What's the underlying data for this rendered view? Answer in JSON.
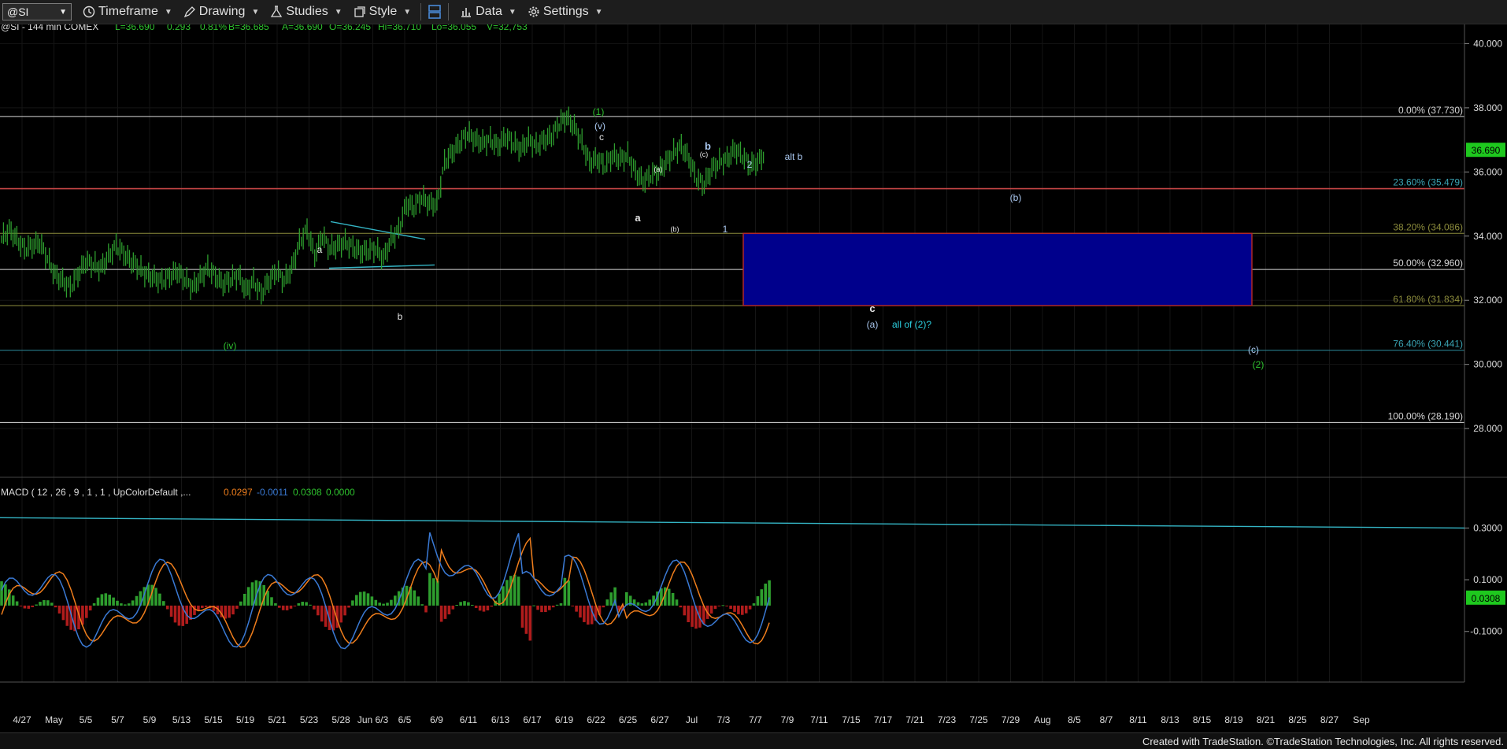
{
  "toolbar": {
    "symbol": "@SI",
    "timeframe": "Timeframe",
    "drawing": "Drawing",
    "studies": "Studies",
    "style": "Style",
    "data": "Data",
    "settings": "Settings"
  },
  "header": {
    "title": "@SI - 144 min  COMEX",
    "L": "L=36.690",
    "chg": "0.293",
    "pct": "0.81%",
    "B": "B=36.685",
    "A": "A=36.690",
    "O": "O=36.245",
    "Hi": "Hi=36.710",
    "Lo": "Lo=36.055",
    "V": "V=32,753"
  },
  "colors": {
    "price": "#2e9e2e",
    "macd_line": "#3a7ad5",
    "signal_line": "#f07e1c",
    "hist_up": "#2e9e2e",
    "hist_down": "#b01c1c",
    "target_box": "#00008c",
    "label_blue": "#aac8f0",
    "label_green": "#2ec22e",
    "trendline": "#34b4c4",
    "red_line": "#c84646",
    "olive_line": "#8c8c3c"
  },
  "chart_data": {
    "type": "line",
    "instrument": "@SI",
    "interval": "144 min",
    "ylim": [
      26.8,
      40.6
    ],
    "y_ticks": [
      "40.000",
      "38.000",
      "36.000",
      "34.000",
      "32.000",
      "30.000",
      "28.000"
    ],
    "last_price": "36.690",
    "x_ticks": [
      "4/27",
      "May",
      "5/5",
      "5/7",
      "5/9",
      "5/13",
      "5/15",
      "5/19",
      "5/21",
      "5/23",
      "5/28",
      "Jun 6/3",
      "6/5",
      "6/9",
      "6/11",
      "6/13",
      "6/17",
      "6/19",
      "6/22",
      "6/25",
      "6/27",
      "Jul",
      "7/3",
      "7/7",
      "7/9",
      "7/11",
      "7/15",
      "7/17",
      "7/21",
      "7/23",
      "7/25",
      "7/29",
      "Aug",
      "8/5",
      "8/7",
      "8/11",
      "8/13",
      "8/15",
      "8/19",
      "8/21",
      "8/25",
      "8/27",
      "Sep"
    ],
    "price_path": [
      [
        0,
        33.9
      ],
      [
        1,
        34.2
      ],
      [
        3,
        33.6
      ],
      [
        5,
        33.8
      ],
      [
        7,
        32.8
      ],
      [
        9,
        32.4
      ],
      [
        11,
        33.2
      ],
      [
        13,
        33.0
      ],
      [
        15,
        33.7
      ],
      [
        17,
        33.2
      ],
      [
        19,
        32.8
      ],
      [
        21,
        32.6
      ],
      [
        23,
        32.9
      ],
      [
        25,
        32.4
      ],
      [
        27,
        33.0
      ],
      [
        29,
        32.5
      ],
      [
        31,
        32.8
      ],
      [
        32,
        32.3
      ],
      [
        33,
        32.6
      ],
      [
        34,
        32.2
      ],
      [
        35,
        32.6
      ],
      [
        36,
        32.9
      ],
      [
        37,
        32.6
      ],
      [
        38,
        33.0
      ],
      [
        39,
        33.8
      ],
      [
        40,
        34.2
      ],
      [
        41,
        33.4
      ],
      [
        42,
        34.0
      ],
      [
        43,
        33.6
      ],
      [
        45,
        33.8
      ],
      [
        47,
        33.5
      ],
      [
        49,
        33.6
      ],
      [
        50,
        33.3
      ],
      [
        51,
        33.9
      ],
      [
        52,
        34.2
      ],
      [
        53,
        35.0
      ],
      [
        54,
        34.9
      ],
      [
        55,
        35.2
      ],
      [
        56,
        35.0
      ],
      [
        57,
        35.0
      ],
      [
        58,
        36.3
      ],
      [
        59,
        36.6
      ],
      [
        60,
        36.9
      ],
      [
        61,
        37.2
      ],
      [
        62,
        37.0
      ],
      [
        63,
        36.9
      ],
      [
        64,
        37.0
      ],
      [
        65,
        36.8
      ],
      [
        66,
        37.1
      ],
      [
        67,
        36.9
      ],
      [
        68,
        36.7
      ],
      [
        69,
        37.0
      ],
      [
        70,
        36.8
      ],
      [
        71,
        37.0
      ],
      [
        72,
        37.1
      ],
      [
        73,
        37.5
      ],
      [
        74,
        37.7
      ],
      [
        75,
        37.4
      ],
      [
        76,
        36.9
      ],
      [
        77,
        36.3
      ],
      [
        78,
        36.4
      ],
      [
        79,
        36.2
      ],
      [
        80,
        36.5
      ],
      [
        81,
        36.4
      ],
      [
        82,
        36.5
      ],
      [
        83,
        36.0
      ],
      [
        84,
        35.7
      ],
      [
        85,
        35.9
      ],
      [
        86,
        36.0
      ],
      [
        87,
        36.3
      ],
      [
        88,
        36.6
      ],
      [
        89,
        36.8
      ],
      [
        90,
        36.4
      ],
      [
        91,
        35.8
      ],
      [
        92,
        35.6
      ],
      [
        93,
        36.1
      ],
      [
        94,
        36.3
      ],
      [
        95,
        36.4
      ],
      [
        96,
        36.7
      ],
      [
        97,
        36.5
      ],
      [
        98,
        36.2
      ],
      [
        99,
        36.3
      ],
      [
        100,
        36.6
      ]
    ],
    "fib_levels": [
      {
        "label": "0.00% (37.730)",
        "value": 37.73
      },
      {
        "label": "23.60% (35.479)",
        "value": 35.479
      },
      {
        "label": "38.20% (34.086)",
        "value": 34.086
      },
      {
        "label": "50.00% (32.960)",
        "value": 32.96
      },
      {
        "label": "61.80% (31.834)",
        "value": 31.834
      },
      {
        "label": "76.40% (30.441)",
        "value": 30.441
      },
      {
        "label": "100.00% (28.190)",
        "value": 28.19
      }
    ],
    "target_zone": {
      "top": 34.086,
      "bottom": 31.834
    },
    "wave_labels": [
      {
        "text": "(1)",
        "color": "green"
      },
      {
        "text": "(v)",
        "color": "blue"
      },
      {
        "text": "c",
        "color": "white"
      },
      {
        "text": "b",
        "color": "blue"
      },
      {
        "text": "(c)",
        "color": "white"
      },
      {
        "text": "(a)",
        "color": "white"
      },
      {
        "text": "2",
        "color": "blue"
      },
      {
        "text": "alt b",
        "color": "blue"
      },
      {
        "text": "(b)",
        "color": "blue"
      },
      {
        "text": "a",
        "color": "white"
      },
      {
        "text": "(b)",
        "color": "white"
      },
      {
        "text": "1",
        "color": "blue"
      },
      {
        "text": "a",
        "color": "white"
      },
      {
        "text": "b",
        "color": "white"
      },
      {
        "text": "(iv)",
        "color": "green"
      },
      {
        "text": "c",
        "color": "white"
      },
      {
        "text": "(a)",
        "color": "blue"
      },
      {
        "text": "all of (2)?",
        "color": "cyan"
      },
      {
        "text": "(c)",
        "color": "blue"
      },
      {
        "text": "(2)",
        "color": "green"
      }
    ],
    "macd": {
      "label": "MACD ( 12 , 26 , 9 , 1 , 1 , UpColorDefault ,...",
      "values": [
        "0.0297",
        "-0.0011",
        "0.0308",
        "0.0000"
      ],
      "y_ticks": [
        "0.3000",
        "0.1000",
        "-0.1000"
      ],
      "last_value": "0.0308",
      "ylim": [
        -0.25,
        0.42
      ]
    }
  },
  "footer": {
    "text": "Created with TradeStation. ©TradeStation Technologies, Inc. All rights reserved."
  }
}
